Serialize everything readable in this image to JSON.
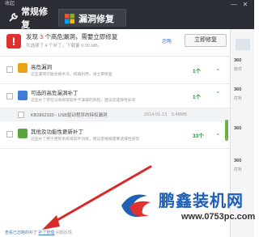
{
  "header": {
    "collapse_label": "收起",
    "tabs": [
      {
        "label": "常规修复"
      },
      {
        "label": "漏洞修复"
      }
    ],
    "window_controls": [
      "minimize",
      "close"
    ]
  },
  "alert": {
    "title_pre": "发现",
    "title_count": "3",
    "title_mid": "个高危漏洞，需要立即修复",
    "subtitle": "共选择了 4 个补丁，下载量 0.00 MB。",
    "ignore_label": "忽略",
    "fix_button": "立即修复"
  },
  "rows": [
    {
      "title": "高危漏洞",
      "desc": "这些漏洞可能会被木马、病毒利用，请立即修复",
      "count": "1个"
    },
    {
      "title": "可选的高危漏洞补丁",
      "desc": "这些补丁存在与系统或软件不兼容的风险，建议您选择性安装",
      "count": "1个"
    },
    {
      "name": "KB2862330 - USB驱动程序的特权漏洞",
      "date": "2014-01-13",
      "size": "5.48MB"
    },
    {
      "title": "其他及功能性更新补丁",
      "desc": "这些补丁用于更新系统或软件功能，建议您根据需要选择性安装",
      "count": "33个"
    }
  ],
  "right_strip": {
    "lines": [
      "360",
      "软件",
      "360",
      "打补",
      "360",
      "360",
      "打补"
    ]
  },
  "bottom": {
    "text_a": "查看已忽略的补丁",
    "link": "补丁管理",
    "text_b": "问题反馈"
  },
  "watermark": {
    "title": "鹏鑫装机网",
    "url": "www.0753pc.com"
  },
  "colors": {
    "header_bg": "#2a2d33",
    "alert_red": "#e03131",
    "link_blue": "#4a7fc1",
    "success_green": "#2f8a3e",
    "arrow_red": "#d62b2b"
  }
}
